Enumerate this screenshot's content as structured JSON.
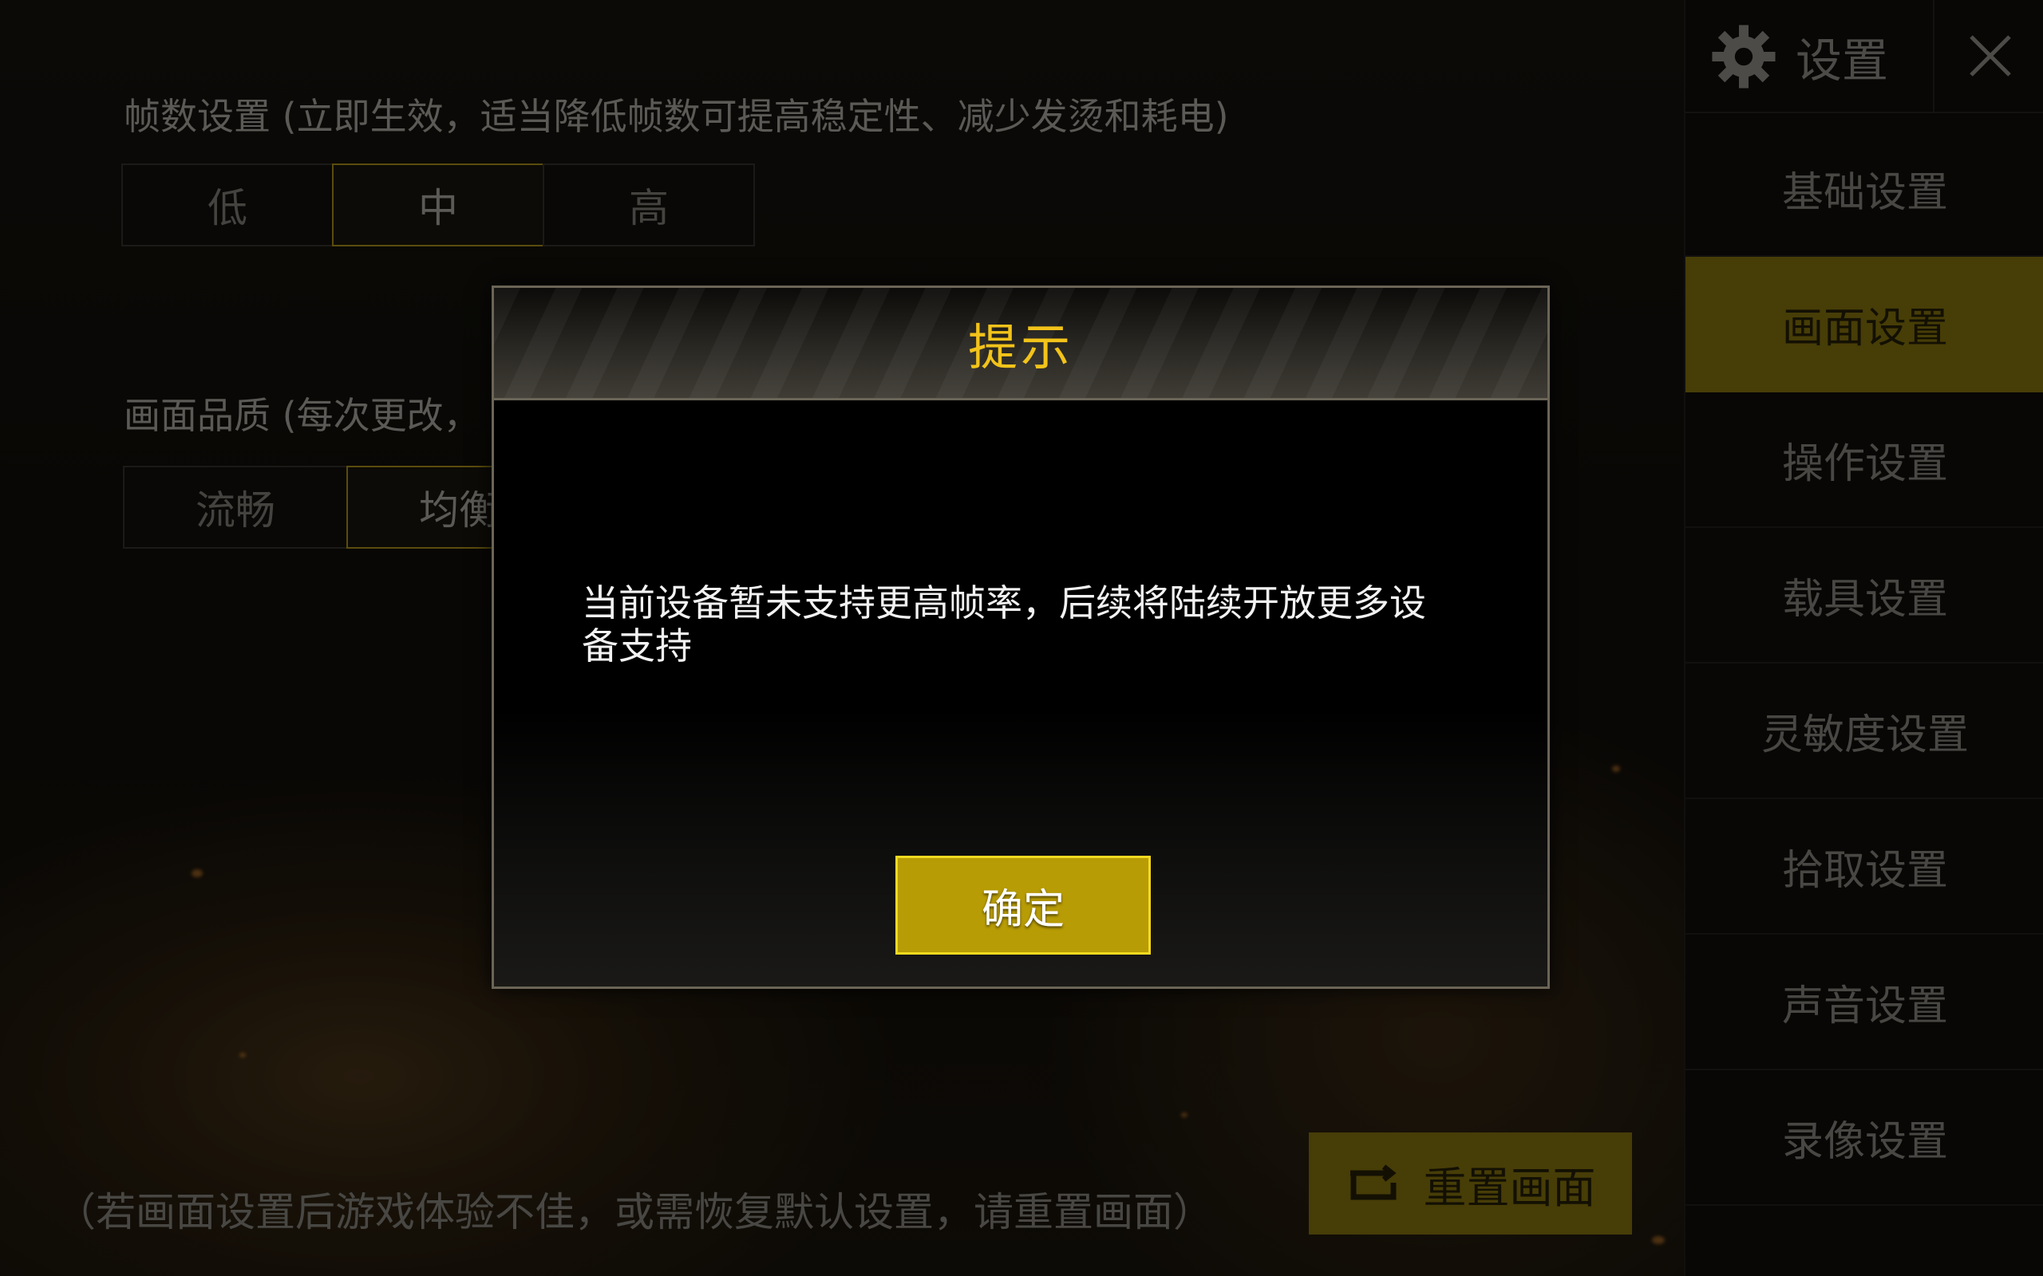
{
  "frame_rate": {
    "label": "帧数设置 (立即生效，适当降低帧数可提高稳定性、减少发烫和耗电)",
    "options": [
      "低",
      "中",
      "高"
    ],
    "selected": "中"
  },
  "quality": {
    "label_visible": "画面品质 (每次更改，",
    "options_visible": [
      "流畅",
      "均衡"
    ],
    "selected": "均衡"
  },
  "footer": {
    "note": "（若画面设置后游戏体验不佳，或需恢复默认设置，请重置画面）",
    "reset_label": "重置画面"
  },
  "sidebar": {
    "title": "设置",
    "items": [
      {
        "label": "基础设置"
      },
      {
        "label": "画面设置",
        "active": true
      },
      {
        "label": "操作设置"
      },
      {
        "label": "载具设置"
      },
      {
        "label": "灵敏度设置"
      },
      {
        "label": "拾取设置"
      },
      {
        "label": "声音设置"
      },
      {
        "label": "录像设置"
      }
    ]
  },
  "dialog": {
    "title": "提示",
    "message": "当前设备暂未支持更高帧率，后续将陆续开放更多设备支持",
    "confirm": "确定"
  },
  "colors": {
    "accent": "#b89c05",
    "accent_border": "#f3da20",
    "title": "#f2c31a"
  },
  "icons": [
    "gear-icon",
    "close-icon",
    "reset-icon"
  ]
}
